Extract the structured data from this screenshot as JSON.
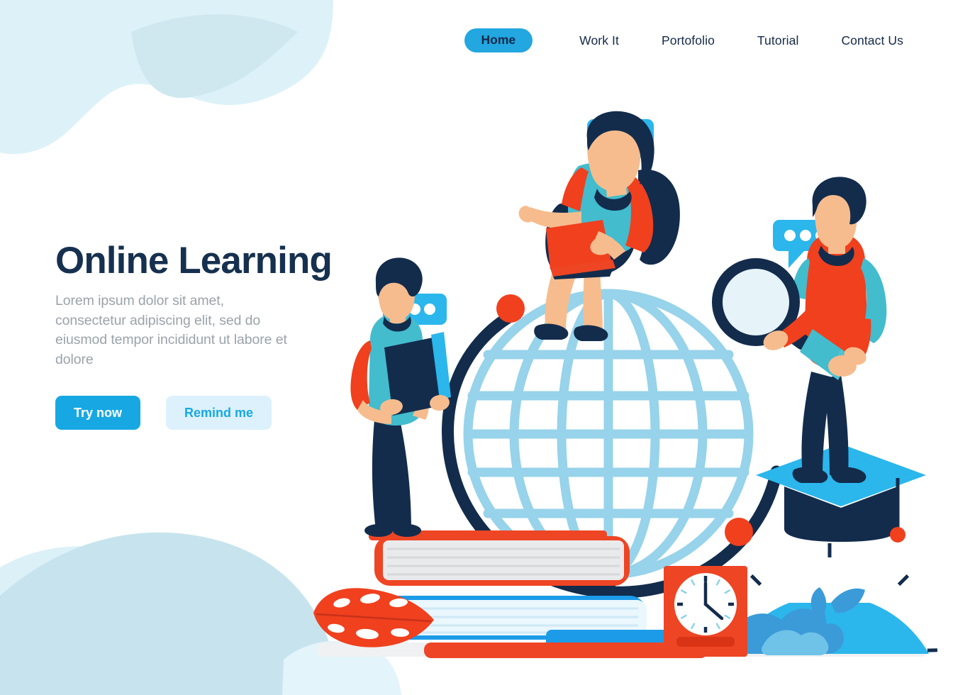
{
  "nav": {
    "items": [
      {
        "label": "Home",
        "active": true
      },
      {
        "label": "Work It",
        "active": false
      },
      {
        "label": "Portofolio",
        "active": false
      },
      {
        "label": "Tutorial",
        "active": false
      },
      {
        "label": "Contact Us",
        "active": false
      }
    ]
  },
  "hero": {
    "title": "Online Learning",
    "description": "Lorem ipsum dolor sit amet, consectetur adipiscing elit, sed do eiusmod tempor incididunt ut labore et dolore",
    "primary_button": "Try now",
    "secondary_button": "Remind me"
  },
  "colors": {
    "accent_cyan": "#22A7E0",
    "primary_blue": "#17A8E3",
    "ghost_blue_bg": "#DCF1FB",
    "navy": "#13294B",
    "navy_dark": "#132C4C",
    "heading_navy": "#16304F",
    "body_grey": "#9AA3AA",
    "red": "#F0401E",
    "red_soft": "#EE4524",
    "teal": "#43BCCD",
    "teal_light": "#4EC3D2",
    "globe_blue": "#97D3EA",
    "skin": "#F6BC8E",
    "blob_light": "#DDF2F8",
    "blob_mid": "#C7E4EE",
    "ground_grey": "#EFF1F2"
  },
  "illustration": {
    "description": "Flat vector scene: three people around a large globe with books, clock, protractor and graduation cap",
    "elements": [
      "chat-bubble",
      "globe",
      "woman-with-laptop",
      "man-with-book",
      "man-with-magnifier",
      "graduation-cap",
      "book-stack",
      "monstera-leaf",
      "clock-box",
      "protractor"
    ]
  }
}
